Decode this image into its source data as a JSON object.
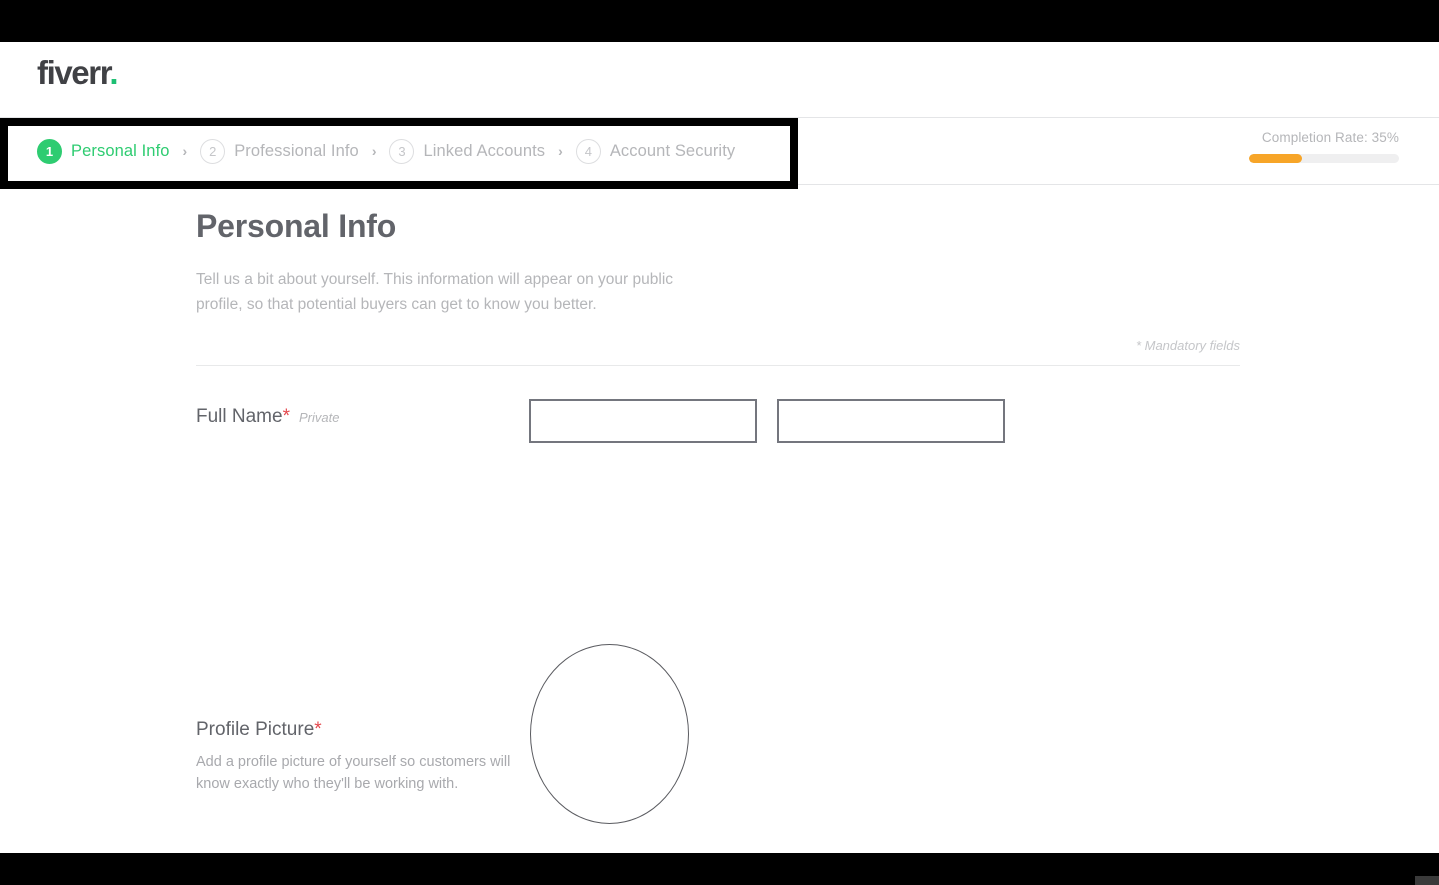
{
  "brand": {
    "logo_text": "fiverr",
    "logo_dot": ".",
    "green": "#2ecc71",
    "orange": "#f7a528",
    "required_red": "#e4484d"
  },
  "steps": [
    {
      "number": "1",
      "label": "Personal Info",
      "state": "active"
    },
    {
      "number": "2",
      "label": "Professional Info",
      "state": "inactive"
    },
    {
      "number": "3",
      "label": "Linked Accounts",
      "state": "inactive"
    },
    {
      "number": "4",
      "label": "Account Security",
      "state": "inactive"
    }
  ],
  "step_separator": "›",
  "completion": {
    "label": "Completion Rate: 35%",
    "percent": 35
  },
  "main": {
    "title": "Personal Info",
    "subtitle": "Tell us a bit about yourself. This information will appear on your public profile, so that potential buyers can get to know you better.",
    "mandatory_note": "* Mandatory fields"
  },
  "full_name": {
    "label": "Full Name",
    "required_mark": "*",
    "privacy_tag": "Private",
    "first_name_value": "",
    "first_name_placeholder": "",
    "last_name_value": "",
    "last_name_placeholder": ""
  },
  "profile_picture": {
    "title": "Profile Picture",
    "required_mark": "*",
    "description": "Add a profile picture of yourself so customers will know exactly who they'll be working with."
  }
}
